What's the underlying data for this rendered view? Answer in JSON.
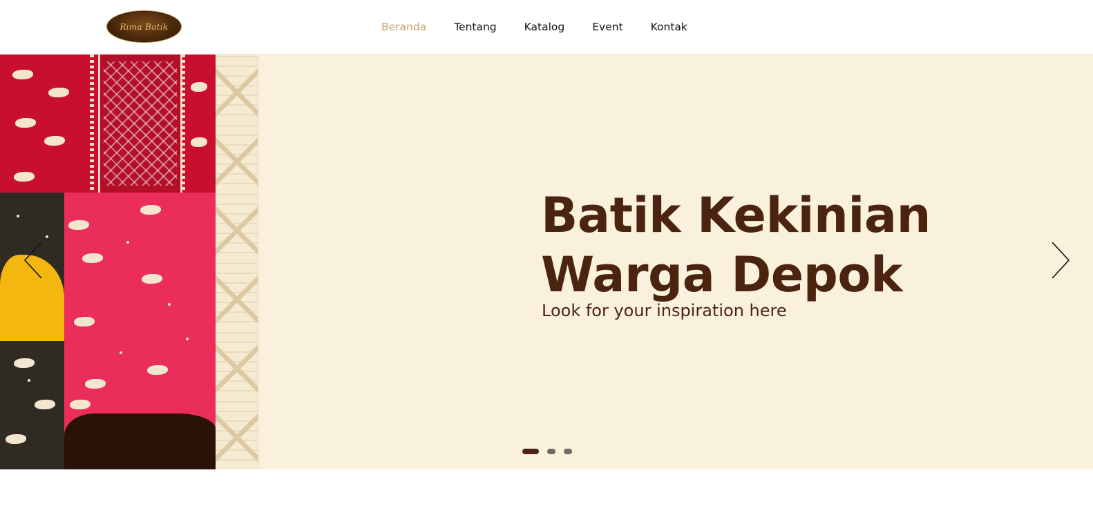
{
  "header": {
    "logo_text": "Rima Batik",
    "nav": [
      {
        "label": "Beranda",
        "active": true
      },
      {
        "label": "Tentang",
        "active": false
      },
      {
        "label": "Katalog",
        "active": false
      },
      {
        "label": "Event",
        "active": false
      },
      {
        "label": "Kontak",
        "active": false
      }
    ]
  },
  "hero": {
    "title_line1": "Batik Kekinian",
    "title_line2": "Warga Depok",
    "subtitle": "Look for your inspiration here",
    "prev_icon": "chevron-left-icon",
    "next_icon": "chevron-right-icon",
    "slides_total": 3,
    "active_slide": 1
  },
  "colors": {
    "accent_active_nav": "#c9a06a",
    "hero_bg": "#faf1dc",
    "title_brown": "#4a2410",
    "batik_red": "#c8102e",
    "batik_pink": "#ea2d5a",
    "batik_yellow": "#f3b70f"
  }
}
